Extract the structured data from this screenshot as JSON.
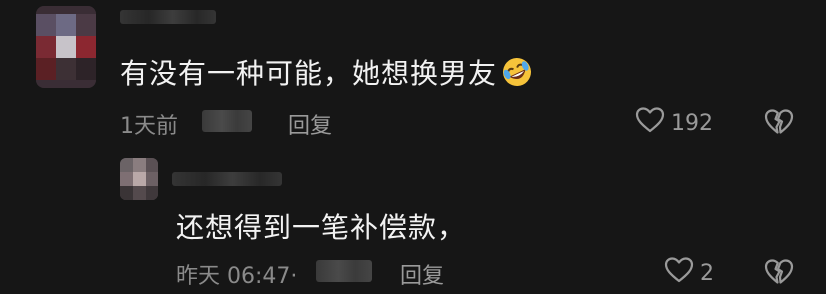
{
  "comments": [
    {
      "text": "有没有一种可能，她想换男友",
      "time": "1天前",
      "reply_label": "回复",
      "like_count": "192",
      "emoji": "rolling-on-floor-laughing"
    },
    {
      "text": "还想得到一笔补偿款，",
      "time": "昨天 06:47·",
      "reply_label": "回复",
      "like_count": "2"
    }
  ],
  "colors": {
    "background": "#161616",
    "text": "#f2f2f2",
    "meta": "#8a8a8a"
  },
  "icons": {
    "like": "heart-outline-icon",
    "dislike": "broken-heart-icon"
  }
}
